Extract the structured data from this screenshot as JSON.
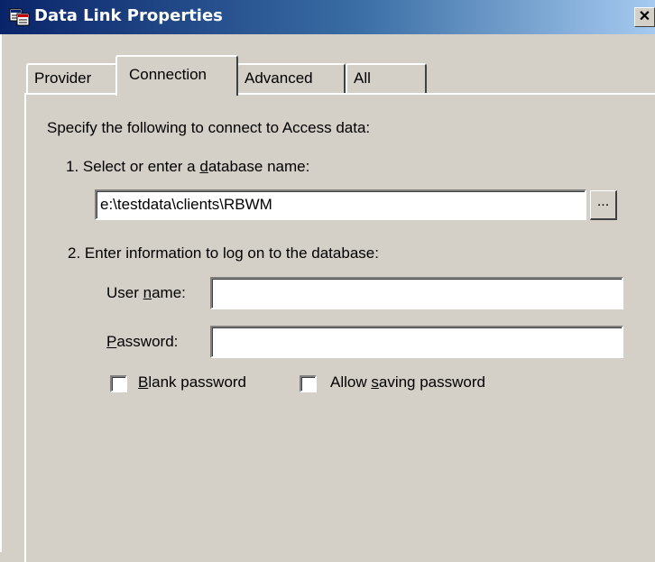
{
  "window": {
    "title": "Data Link Properties",
    "close_glyph": "✕"
  },
  "tabs": {
    "provider": "Provider",
    "connection": "Connection",
    "advanced": "Advanced",
    "all": "All",
    "selected": "Connection"
  },
  "connection": {
    "intro": "Specify the following to connect to Access data:",
    "step1": {
      "prefix": "1. Select or enter a ",
      "accel": "d",
      "suffix": "atabase name:"
    },
    "database_value": "e:\\testdata\\clients\\RBWM",
    "browse_label": "...",
    "step2": "2. Enter information to log on to the database:",
    "username": {
      "prefix": "User ",
      "accel": "n",
      "suffix": "ame:",
      "value": ""
    },
    "password": {
      "prefix": "",
      "accel": "P",
      "suffix": "assword:",
      "value": ""
    },
    "blank_password": {
      "prefix": "",
      "accel": "B",
      "suffix": "lank password",
      "checked": false
    },
    "allow_saving": {
      "prefix": "Allow ",
      "accel": "s",
      "suffix": "aving password",
      "checked": false
    }
  },
  "colors": {
    "face": "#d4d0c8",
    "title_start": "#0a246a",
    "title_end": "#a6caf0"
  }
}
